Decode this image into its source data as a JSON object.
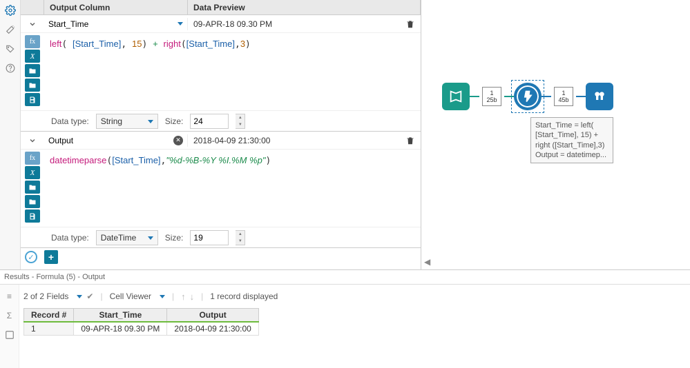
{
  "headers": {
    "output_column": "Output Column",
    "data_preview": "Data Preview"
  },
  "blocks": [
    {
      "output_column": "Start_Time",
      "has_clear": false,
      "preview": "09-APR-18 09.30 PM",
      "expr_html": [
        {
          "t": "fn",
          "v": "left"
        },
        {
          "t": "plain",
          "v": "( "
        },
        {
          "t": "fld",
          "v": "[Start_Time]"
        },
        {
          "t": "plain",
          "v": ", "
        },
        {
          "t": "num",
          "v": "15"
        },
        {
          "t": "plain",
          "v": ") "
        },
        {
          "t": "op",
          "v": "+"
        },
        {
          "t": "plain",
          "v": " "
        },
        {
          "t": "fn",
          "v": "right"
        },
        {
          "t": "plain",
          "v": "("
        },
        {
          "t": "fld",
          "v": "[Start_Time]"
        },
        {
          "t": "plain",
          "v": ","
        },
        {
          "t": "num",
          "v": "3"
        },
        {
          "t": "plain",
          "v": ")"
        }
      ],
      "data_type_label": "Data type:",
      "data_type": "String",
      "size_label": "Size:",
      "size": "24"
    },
    {
      "output_column": "Output",
      "has_clear": true,
      "preview": "2018-04-09 21:30:00",
      "expr_html": [
        {
          "t": "fn",
          "v": "datetimeparse"
        },
        {
          "t": "plain",
          "v": "("
        },
        {
          "t": "fld",
          "v": "[Start_Time]"
        },
        {
          "t": "plain",
          "v": ","
        },
        {
          "t": "str",
          "v": "\"%d-%B-%Y %I.%M %p\""
        },
        {
          "t": "plain",
          "v": ")"
        }
      ],
      "data_type_label": "Data type:",
      "data_type": "DateTime",
      "size_label": "Size:",
      "size": "19"
    }
  ],
  "canvas": {
    "anchor1_top": "1",
    "anchor1_bot": "25b",
    "anchor2_top": "1",
    "anchor2_bot": "45b",
    "tooltip": "Start_Time = left( [Start_Time], 15) + right ([Start_Time],3)\nOutput = datetimep..."
  },
  "results": {
    "title": "Results - Formula (5) - Output",
    "fields_label": "2 of 2 Fields",
    "cell_viewer": "Cell Viewer",
    "records_label": "1 record displayed",
    "columns": [
      "Record #",
      "Start_Time",
      "Output"
    ],
    "rows": [
      {
        "record": "1",
        "start_time": "09-APR-18 09.30 PM",
        "output": "2018-04-09 21:30:00"
      }
    ]
  }
}
